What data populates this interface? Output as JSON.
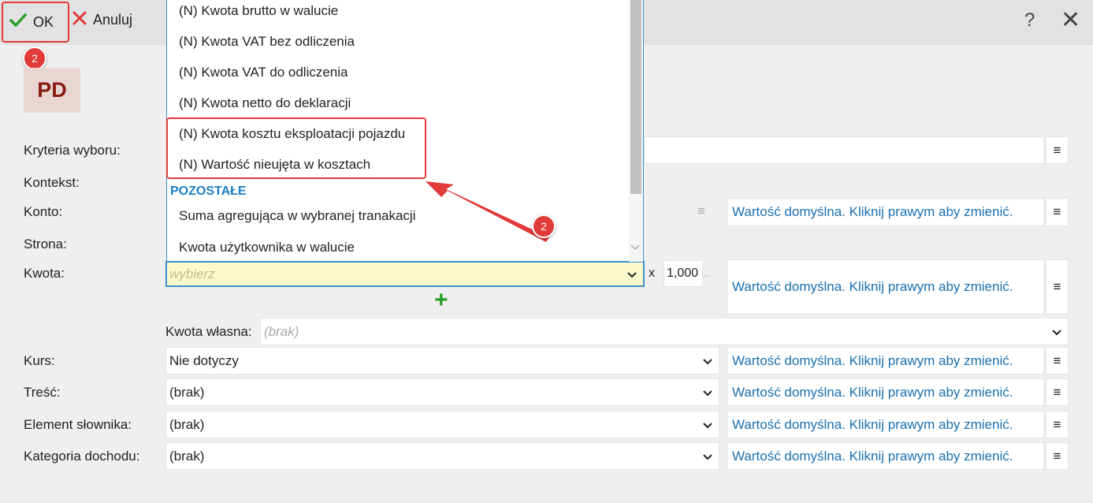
{
  "toolbar": {
    "ok_label": "OK",
    "cancel_label": "Anuluj",
    "help_glyph": "?",
    "close_glyph": "✕"
  },
  "badges": {
    "ok_badge": "2",
    "arrow_badge": "2"
  },
  "logo": {
    "text": "PD"
  },
  "labels": {
    "kryteria": "Kryteria wyboru:",
    "kontekst": "Kontekst:",
    "konto": "Konto:",
    "strona": "Strona:",
    "kwota": "Kwota:",
    "kwota_wlasna": "Kwota własna:",
    "kurs": "Kurs:",
    "tresc": "Treść:",
    "element": "Element słownika:",
    "kategoria": "Kategoria dochodu:"
  },
  "dropdown": {
    "items": [
      "(N) Kwota brutto w walucie",
      "(N) Kwota VAT bez odliczenia",
      "(N) Kwota VAT do odliczenia",
      "(N) Kwota netto do deklaracji",
      "(N) Kwota kosztu eksploatacji pojazdu",
      "(N) Wartość nieujęta w kosztach"
    ],
    "group_label": "POZOSTAŁE",
    "group_items": [
      "Suma agregująca w wybranej tranakacji",
      "Kwota użytkownika w walucie"
    ]
  },
  "kwota": {
    "placeholder": "wybierz",
    "multiplier_x": "x",
    "multiplier_value": "1,000",
    "multiplier_more": "..."
  },
  "kwota_wlasna": {
    "placeholder": "(brak)"
  },
  "kurs": {
    "value": "Nie dotyczy"
  },
  "tresc": {
    "value": "(brak)"
  },
  "element": {
    "value": "(brak)"
  },
  "kategoria": {
    "value": "(brak)"
  },
  "default_text": "Wartość domyślna. Kliknij prawym aby zmienić.",
  "menu_glyph": "≡",
  "colors": {
    "accent": "#1a6fb0",
    "annotation_red": "#e23a3a",
    "focus_blue": "#3c8fd0",
    "add_green": "#2a9d2a"
  },
  "icons": {
    "ok": "check-icon",
    "cancel": "cross-icon",
    "add": "plus-icon"
  }
}
